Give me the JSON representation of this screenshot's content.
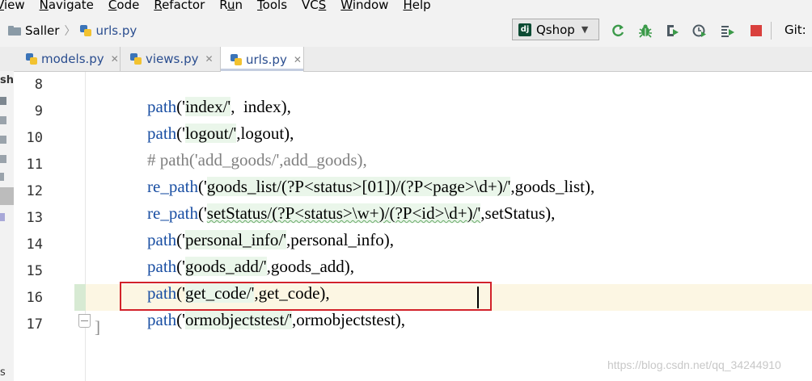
{
  "menu": {
    "items": [
      {
        "pre": "",
        "ul": "V",
        "post": "iew"
      },
      {
        "pre": "",
        "ul": "N",
        "post": "avigate"
      },
      {
        "pre": "",
        "ul": "C",
        "post": "ode"
      },
      {
        "pre": "",
        "ul": "R",
        "post": "efactor"
      },
      {
        "pre": "R",
        "ul": "u",
        "post": "n"
      },
      {
        "pre": "",
        "ul": "T",
        "post": "ools"
      },
      {
        "pre": "VC",
        "ul": "S",
        "post": ""
      },
      {
        "pre": "",
        "ul": "W",
        "post": "indow"
      },
      {
        "pre": "",
        "ul": "H",
        "post": "elp"
      }
    ]
  },
  "nav": {
    "breadcrumb": {
      "folder": "Saller",
      "file": "urls.py"
    },
    "run_config": {
      "icon_text": "dj",
      "label": "Qshop"
    },
    "git_label": "Git:"
  },
  "tabs": [
    {
      "label": "models.py",
      "active": false
    },
    {
      "label": "views.py",
      "active": false
    },
    {
      "label": "urls.py",
      "active": true
    }
  ],
  "left_strip": {
    "labels": [
      "sho",
      "s"
    ]
  },
  "editor": {
    "line_numbers": [
      "8",
      "9",
      "10",
      "11",
      "12",
      "13",
      "14",
      "15",
      "16",
      "17"
    ],
    "current_line": "16",
    "closing_bracket": "]",
    "lines": [
      {
        "fn": "path",
        "open": "('",
        "str": "index/'",
        "rest": ",  index),"
      },
      {
        "fn": "path",
        "open": "('",
        "str": "logout/'",
        "rest": ",logout),"
      },
      {
        "comment": "# path('add_goods/',add_goods),"
      },
      {
        "fn": "re_path",
        "open": "('",
        "str": "goods_list/(?P<status>[01])/(?P<page>\\d+)/'",
        "rest": ",goods_list),"
      },
      {
        "fn": "re_path",
        "open": "('",
        "str": "setStatus/(?P<status>\\w+)/(?P<id>\\d+)/'",
        "rest": ",setStatus),"
      },
      {
        "fn": "path",
        "open": "('",
        "str": "personal_info/'",
        "rest": ",personal_info),"
      },
      {
        "fn": "path",
        "open": "('",
        "str": "goods_add/'",
        "rest": ",goods_add),"
      },
      {
        "fn": "path",
        "open": "('",
        "str": "get_code/'",
        "rest": ",get_code),"
      },
      {
        "fn": "path",
        "open": "('",
        "str": "ormobjectstest/'",
        "rest": ",ormobjectstest),"
      }
    ]
  },
  "watermark": "https://blog.csdn.net/qq_34244910",
  "colors": {
    "function": "#1a4fa3",
    "current_line_bg": "#fcf6e3",
    "annotation_box": "#d2222a",
    "comment": "#808080"
  }
}
